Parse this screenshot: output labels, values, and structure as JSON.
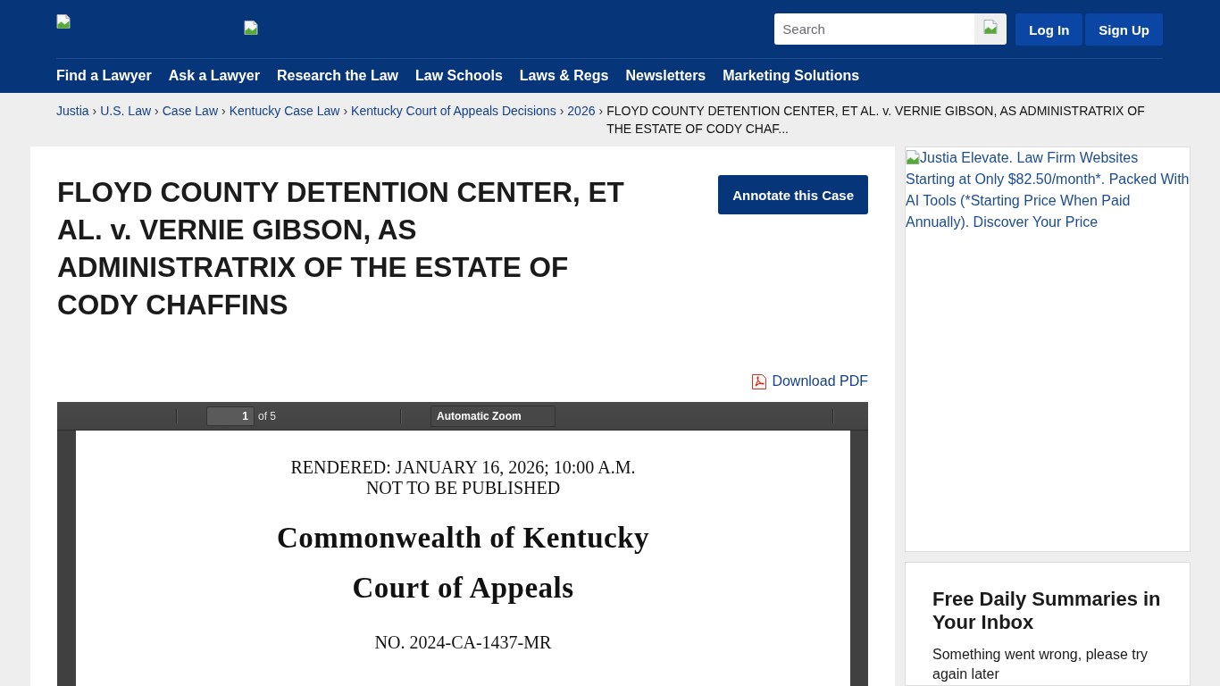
{
  "header": {
    "search": {
      "placeholder": "Search"
    },
    "buttons": [
      "Log In",
      "Sign Up"
    ],
    "nav": [
      "Find a Lawyer",
      "Ask a Lawyer",
      "Research the Law",
      "Law Schools",
      "Laws & Regs",
      "Newsletters",
      "Marketing Solutions"
    ]
  },
  "breadcrumb": {
    "items": [
      {
        "kind": "link",
        "text": "Justia"
      },
      {
        "kind": "separator",
        "text": "›"
      },
      {
        "kind": "link",
        "text": "U.S. Law"
      },
      {
        "kind": "separator",
        "text": "›"
      },
      {
        "kind": "link",
        "text": "Case Law"
      },
      {
        "kind": "separator",
        "text": "›"
      },
      {
        "kind": "link",
        "text": "Kentucky Case Law"
      },
      {
        "kind": "separator",
        "text": "›"
      },
      {
        "kind": "link",
        "text": "Kentucky Court of Appeals Decisions"
      },
      {
        "kind": "separator",
        "text": "›"
      },
      {
        "kind": "link",
        "text": "2026"
      },
      {
        "kind": "separator",
        "text": "›"
      },
      {
        "kind": "current",
        "text": "FLOYD COUNTY DETENTION CENTER, ET AL. v. VERNIE GIBSON, AS ADMINISTRATRIX OF THE ESTATE OF CODY CHAF..."
      }
    ]
  },
  "case": {
    "title": "FLOYD COUNTY DETENTION CENTER, ET AL. v. VERNIE GIBSON, AS ADMINISTRATRIX OF THE ESTATE OF CODY CHAFFINS",
    "annotate_button": "Annotate this Case",
    "download_link": "Download PDF"
  },
  "pdf_viewer": {
    "page": "1",
    "page_count": "of 5",
    "zoom": "Automatic Zoom",
    "document": [
      {
        "kind": "notice",
        "text": "RENDERED: JANUARY 16, 2026; 10:00 A.M."
      },
      {
        "kind": "notice",
        "text": "NOT TO BE PUBLISHED"
      },
      {
        "kind": "court",
        "text": "Commonwealth of Kentucky"
      },
      {
        "kind": "court",
        "text": "Court of Appeals"
      },
      {
        "kind": "docket",
        "text": "NO. 2024-CA-1437-MR"
      }
    ]
  },
  "sidebar": {
    "ad": {
      "alt_text": "Justia Elevate. Law Firm Websites Starting at Only $82.50/month*. Packed With AI Tools (*Starting Price When Paid Annually). Discover Your Price"
    },
    "newsletter": {
      "title": "Free Daily Summaries in Your Inbox",
      "message": "Something went wrong, please try again later"
    }
  }
}
